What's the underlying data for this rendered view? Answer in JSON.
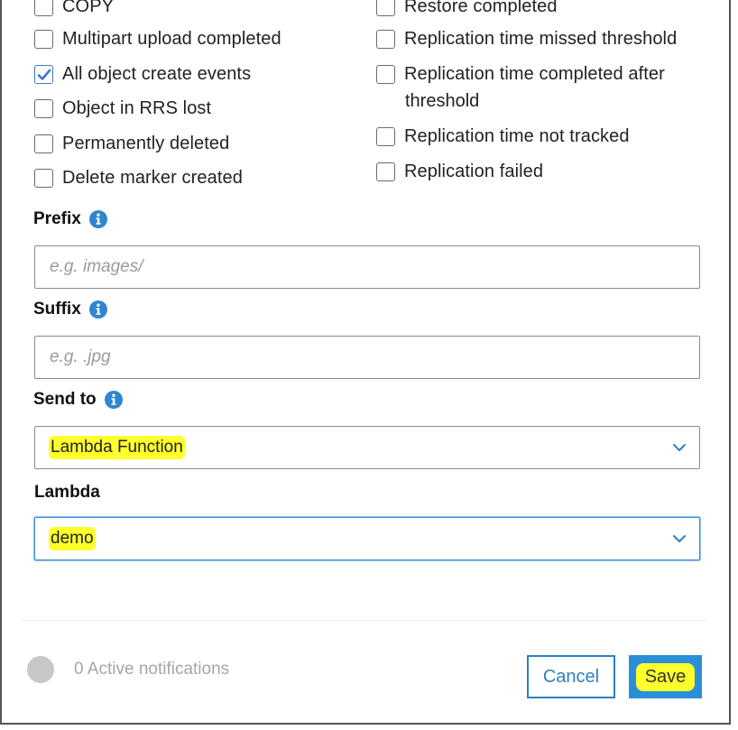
{
  "events": {
    "left": [
      {
        "label": "COPY",
        "checked": false
      },
      {
        "label": "Multipart upload completed",
        "checked": false
      },
      {
        "label": "All object create events",
        "checked": true
      },
      {
        "label": "Object in RRS lost",
        "checked": false
      },
      {
        "label": "Permanently deleted",
        "checked": false
      },
      {
        "label": "Delete marker created",
        "checked": false
      }
    ],
    "right": [
      {
        "label": "Restore completed",
        "checked": false
      },
      {
        "label": "Replication time missed threshold",
        "checked": false
      },
      {
        "label": "Replication time completed after",
        "label_line2": "threshold",
        "checked": false
      },
      {
        "label": "Replication time not tracked",
        "checked": false
      },
      {
        "label": "Replication failed",
        "checked": false
      }
    ]
  },
  "prefix": {
    "label": "Prefix",
    "placeholder": "e.g. images/",
    "value": ""
  },
  "suffix": {
    "label": "Suffix",
    "placeholder": "e.g. .jpg",
    "value": ""
  },
  "send_to": {
    "label": "Send to",
    "selected": "Lambda Function"
  },
  "lambda": {
    "label": "Lambda",
    "selected": "demo"
  },
  "footer": {
    "status_text": "0 Active notifications",
    "cancel_label": "Cancel",
    "save_label": "Save"
  },
  "colors": {
    "accent": "#2e7fc2",
    "highlight": "#ffff2b",
    "checkbox_check": "#3d7bc4"
  }
}
